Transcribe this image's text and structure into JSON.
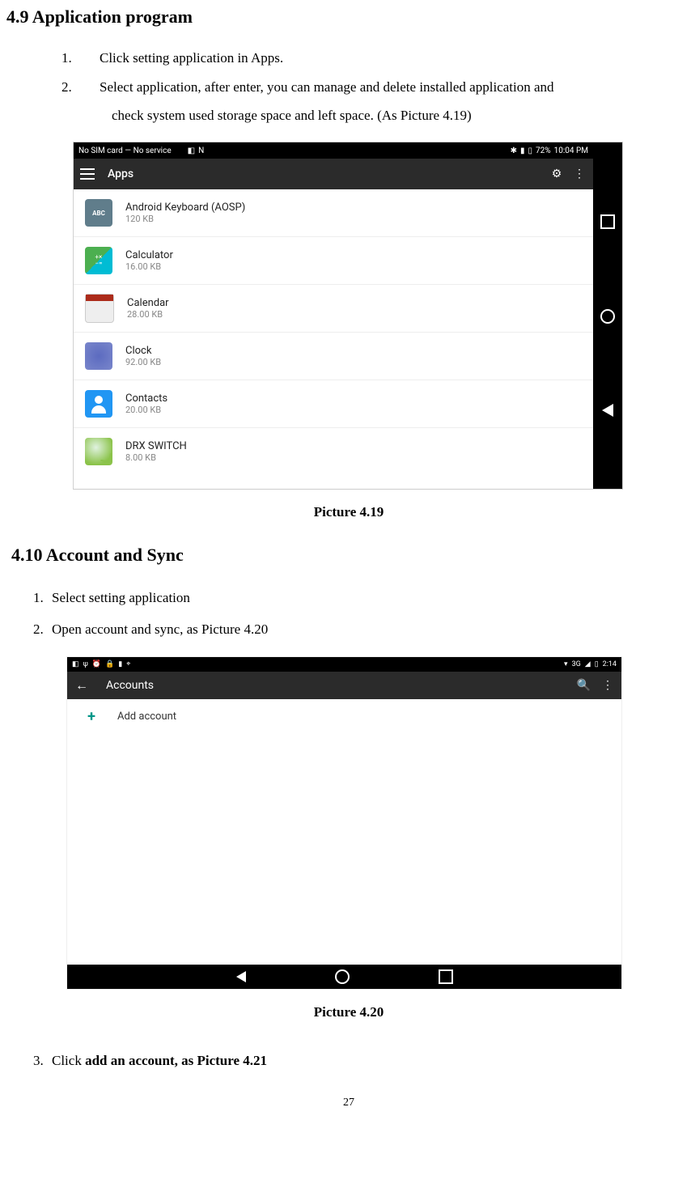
{
  "section49": {
    "heading": "4.9  Application program",
    "steps": [
      "Click setting application in Apps.",
      "Select application, after enter, you can manage and delete installed application and"
    ],
    "step2_cont": "check system used storage space and left space. (As Picture 4.19)"
  },
  "shot1": {
    "status_left": "No SIM card — No service",
    "battery": "72%",
    "time": "10:04 PM",
    "appbar_title": "Apps",
    "apps": [
      {
        "name": "Android Keyboard (AOSP)",
        "size": "120 KB"
      },
      {
        "name": "Calculator",
        "size": "16.00 KB"
      },
      {
        "name": "Calendar",
        "size": "28.00 KB"
      },
      {
        "name": "Clock",
        "size": "92.00 KB"
      },
      {
        "name": "Contacts",
        "size": "20.00 KB"
      },
      {
        "name": "DRX SWITCH",
        "size": "8.00 KB"
      }
    ]
  },
  "caption1": "Picture 4.19",
  "section410": {
    "heading": "4.10 Account and Sync",
    "steps": [
      "Select setting application",
      "Open account and sync, as Picture 4.20"
    ]
  },
  "shot2": {
    "signal": "3G",
    "time": "2:14",
    "appbar_title": "Accounts",
    "add_label": "Add account"
  },
  "caption2": "Picture 4.20",
  "step3_prefix": "Click ",
  "step3_bold": "add an account, as Picture 4.21",
  "page_number": "27"
}
